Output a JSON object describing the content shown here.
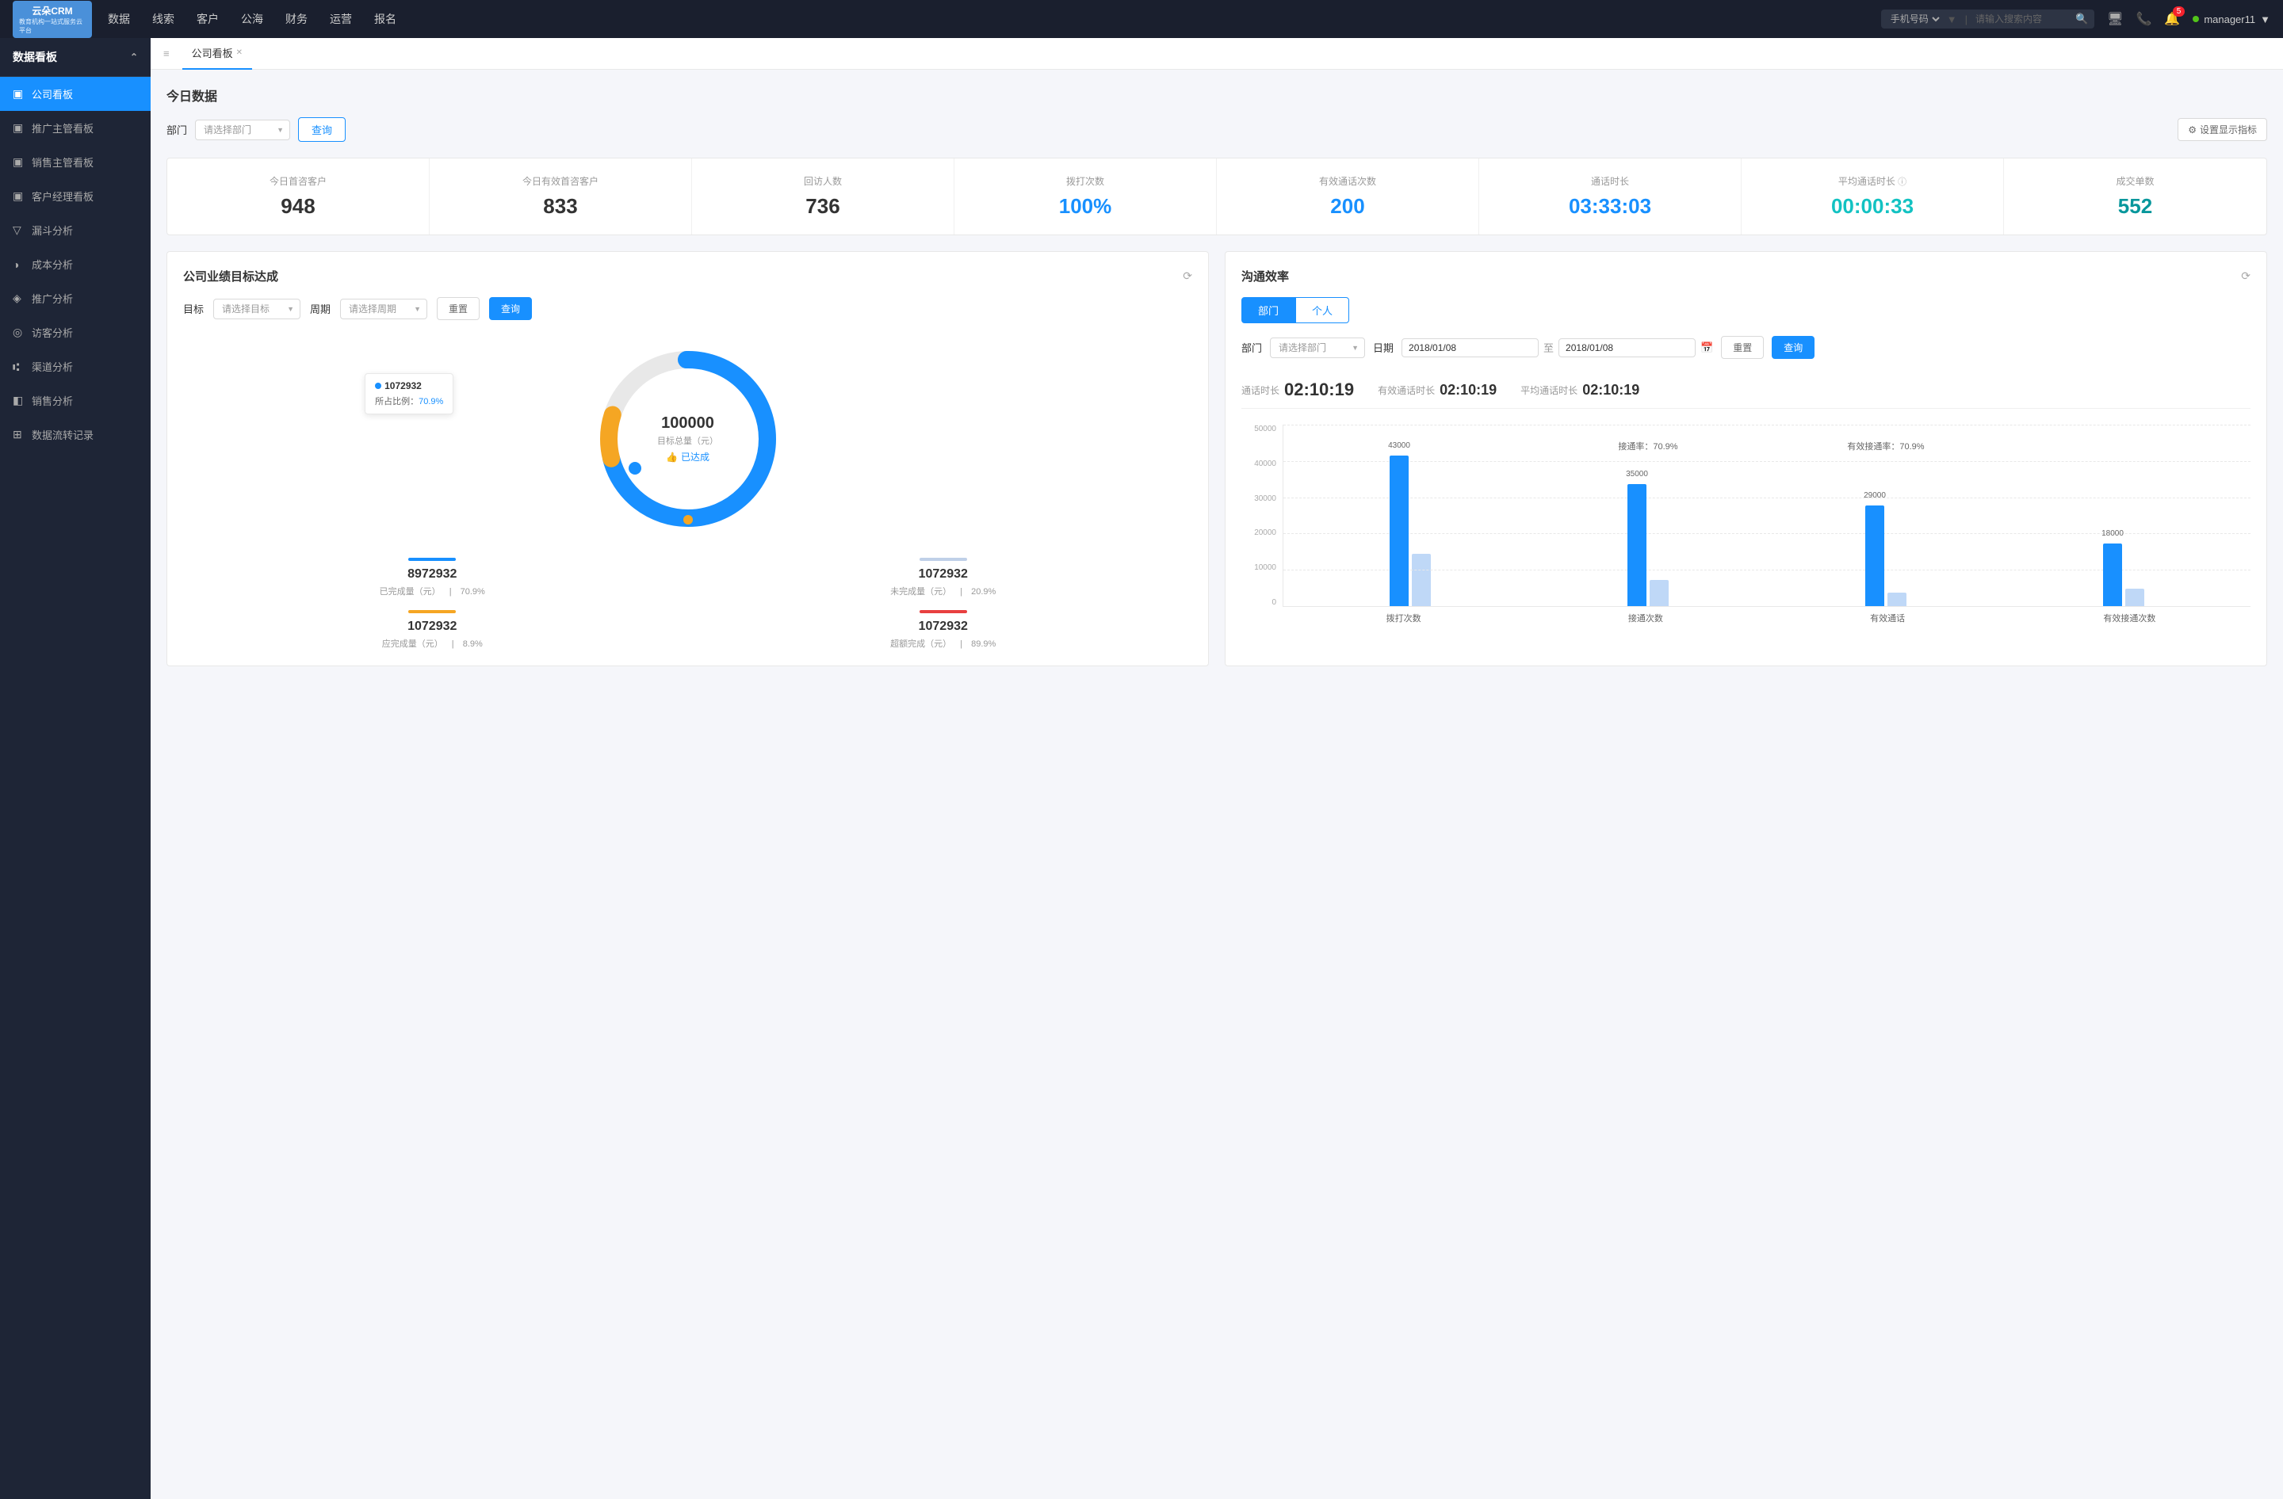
{
  "app": {
    "name": "云朵CRM",
    "subtitle": "教育机构一站式服务云平台"
  },
  "topnav": {
    "items": [
      "数据",
      "线索",
      "客户",
      "公海",
      "财务",
      "运营",
      "报名"
    ],
    "search": {
      "placeholder": "请输入搜索内容",
      "filter": "手机号码"
    },
    "notification_count": "5",
    "username": "manager11"
  },
  "sidebar": {
    "group_title": "数据看板",
    "items": [
      {
        "label": "公司看板",
        "active": true
      },
      {
        "label": "推广主管看板",
        "active": false
      },
      {
        "label": "销售主管看板",
        "active": false
      },
      {
        "label": "客户经理看板",
        "active": false
      },
      {
        "label": "漏斗分析",
        "active": false
      },
      {
        "label": "成本分析",
        "active": false
      },
      {
        "label": "推广分析",
        "active": false
      },
      {
        "label": "访客分析",
        "active": false
      },
      {
        "label": "渠道分析",
        "active": false
      },
      {
        "label": "销售分析",
        "active": false
      },
      {
        "label": "数据流转记录",
        "active": false
      }
    ]
  },
  "tab": {
    "label": "公司看板"
  },
  "today_section": {
    "title": "今日数据",
    "filter_label": "部门",
    "filter_placeholder": "请选择部门",
    "query_btn": "查询",
    "settings_btn": "设置显示指标",
    "stats": [
      {
        "label": "今日首咨客户",
        "value": "948",
        "color": "black"
      },
      {
        "label": "今日有效首咨客户",
        "value": "833",
        "color": "black"
      },
      {
        "label": "回访人数",
        "value": "736",
        "color": "black"
      },
      {
        "label": "拨打次数",
        "value": "100%",
        "color": "blue"
      },
      {
        "label": "有效通话次数",
        "value": "200",
        "color": "blue"
      },
      {
        "label": "通话时长",
        "value": "03:33:03",
        "color": "blue"
      },
      {
        "label": "平均通话时长",
        "value": "00:00:33",
        "color": "cyan"
      },
      {
        "label": "成交单数",
        "value": "552",
        "color": "teal"
      }
    ]
  },
  "goal_panel": {
    "title": "公司业绩目标达成",
    "goal_label": "目标",
    "goal_placeholder": "请选择目标",
    "period_label": "周期",
    "period_placeholder": "请选择周期",
    "reset_btn": "重置",
    "query_btn": "查询",
    "donut": {
      "center_num": "100000",
      "center_label": "目标总量（元）",
      "achieved": "已达成",
      "tooltip_value": "1072932",
      "tooltip_percent": "70.9%"
    },
    "stats": [
      {
        "color": "#1890ff",
        "num": "8972932",
        "desc1": "已完成量（元）",
        "sep": "|",
        "desc2": "70.9%"
      },
      {
        "color": "#c0d0e8",
        "num": "1072932",
        "desc1": "未完成量（元）",
        "sep": "|",
        "desc2": "20.9%"
      },
      {
        "color": "#f5a623",
        "num": "1072932",
        "desc1": "应完成量（元）",
        "sep": "|",
        "desc2": "8.9%"
      },
      {
        "color": "#e84040",
        "num": "1072932",
        "desc1": "超额完成（元）",
        "sep": "|",
        "desc2": "89.9%"
      }
    ]
  },
  "efficiency_panel": {
    "title": "沟通效率",
    "tabs": [
      "部门",
      "个人"
    ],
    "active_tab": 0,
    "dept_label": "部门",
    "dept_placeholder": "请选择部门",
    "date_label": "日期",
    "date_from": "2018/01/08",
    "date_to": "2018/01/08",
    "reset_btn": "重置",
    "query_btn": "查询",
    "call_stats": [
      {
        "label": "通话时长",
        "value": "02:10:19",
        "large": true
      },
      {
        "label": "有效通话时长",
        "value": "02:10:19"
      },
      {
        "label": "平均通话时长",
        "value": "02:10:19"
      }
    ],
    "chart": {
      "y_labels": [
        "50000",
        "40000",
        "30000",
        "20000",
        "10000",
        "0"
      ],
      "groups": [
        {
          "label": "拨打次数",
          "bars": [
            {
              "height_pct": 86,
              "value": "43000",
              "type": "blue"
            },
            {
              "height_pct": 30,
              "value": "",
              "type": "light"
            }
          ]
        },
        {
          "label": "接通次数",
          "rate_label": "接通率：70.9%",
          "bars": [
            {
              "height_pct": 70,
              "value": "35000",
              "type": "blue"
            },
            {
              "height_pct": 15,
              "value": "",
              "type": "light"
            }
          ]
        },
        {
          "label": "有效通话",
          "rate_label": "有效接通率：70.9%",
          "bars": [
            {
              "height_pct": 58,
              "value": "29000",
              "type": "blue"
            },
            {
              "height_pct": 8,
              "value": "",
              "type": "light"
            }
          ]
        },
        {
          "label": "有效接通次数",
          "bars": [
            {
              "height_pct": 36,
              "value": "18000",
              "type": "blue"
            },
            {
              "height_pct": 10,
              "value": "",
              "type": "light"
            }
          ]
        }
      ]
    }
  }
}
